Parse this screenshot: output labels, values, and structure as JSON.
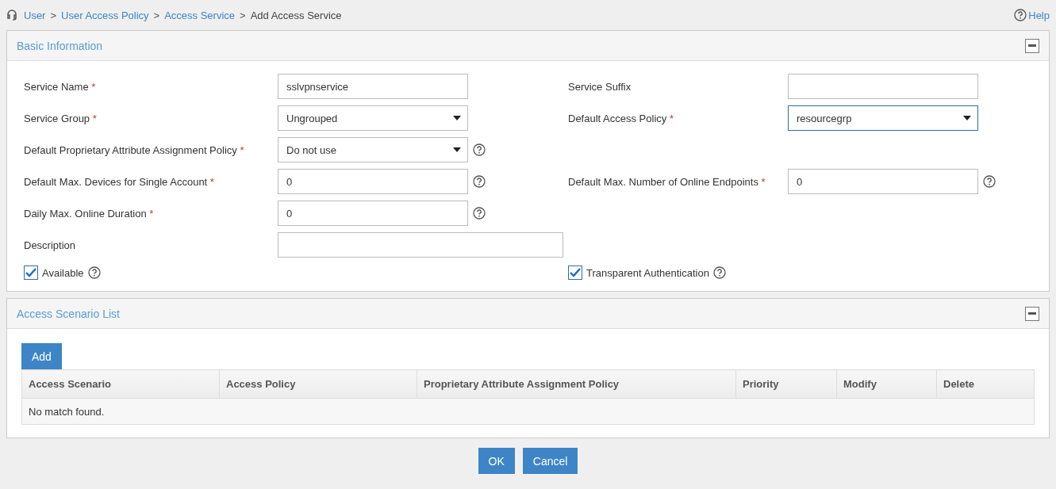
{
  "breadcrumb": {
    "links": [
      "User",
      "User Access Policy",
      "Access Service"
    ],
    "separator": ">",
    "current": "Add Access Service"
  },
  "help": "Help",
  "basic_information": {
    "title": "Basic Information",
    "rows": [
      {
        "left": {
          "label": "Service Name",
          "required_mark": "*",
          "kind": "text",
          "value": "sslvpnservice",
          "help": false
        },
        "right": {
          "label": "Service Suffix",
          "kind": "text",
          "help": false
        }
      },
      {
        "left": {
          "label": "Service Group",
          "required_mark": "*",
          "kind": "select",
          "value": "Ungrouped",
          "help": false
        },
        "right": {
          "label": "Default Access Policy",
          "required_mark": "*",
          "kind": "select",
          "value": "resourcegrp",
          "help": false,
          "focused": true
        }
      },
      {
        "left": {
          "label": "Default Proprietary Attribute Assignment Policy",
          "required_mark": "*",
          "kind": "select",
          "value": "Do not use",
          "help": true
        }
      },
      {
        "left": {
          "label": "Default Max. Devices for Single Account",
          "required_mark": "*",
          "kind": "text",
          "value": "0",
          "help": true
        },
        "right": {
          "label": "Default Max. Number of Online Endpoints",
          "required_mark": "*",
          "kind": "text",
          "value": "0",
          "help": true
        }
      },
      {
        "left": {
          "label": "Daily Max. Online Duration",
          "required_mark": "*",
          "kind": "text",
          "value": "0",
          "help": true
        }
      },
      {
        "left": {
          "label": "Description",
          "kind": "textwide",
          "help": false
        }
      }
    ],
    "checkboxes": [
      {
        "label": "Available",
        "checked": true
      },
      {
        "label": "Transparent Authentication",
        "checked": true
      }
    ]
  },
  "access_scenario_list": {
    "title": "Access Scenario List",
    "add_button": "Add",
    "columns": [
      "Access Scenario",
      "Access Policy",
      "Proprietary Attribute Assignment Policy",
      "Priority",
      "Modify",
      "Delete"
    ],
    "empty_message": "No match found."
  },
  "buttons": [
    "OK",
    "Cancel"
  ]
}
